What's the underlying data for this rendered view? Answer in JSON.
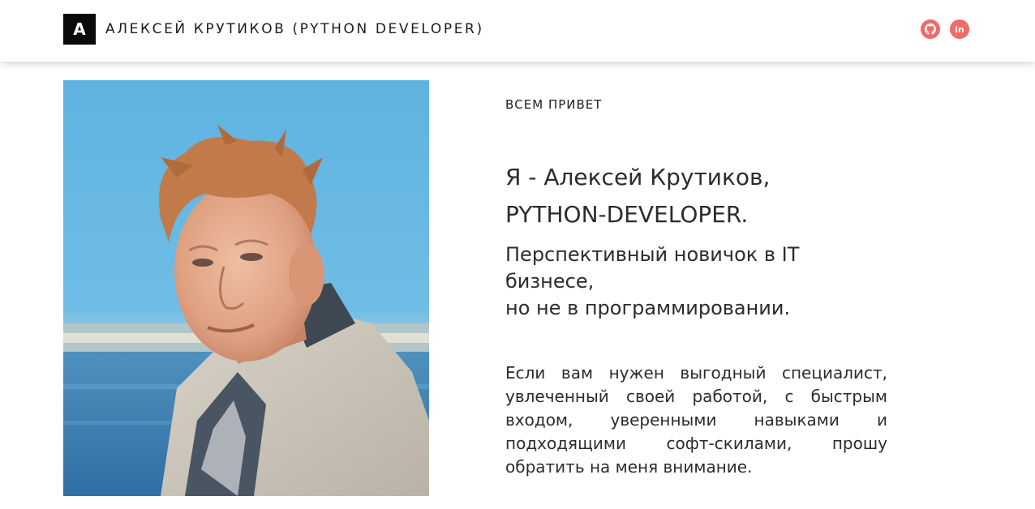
{
  "header": {
    "logo_letter": "A",
    "title": "АЛЕКСЕЙ КРУТИКОВ (PYTHON DEVELOPER)",
    "social": [
      {
        "name": "github",
        "icon": "github-icon"
      },
      {
        "name": "linkedin",
        "icon": "linkedin-icon",
        "glyph": "in"
      }
    ]
  },
  "main": {
    "greeting": "ВСЕМ ПРИВЕТ",
    "headline_line1": "Я - Алексей Крутиков,",
    "headline_line2": "PYTHON-DEVELOPER.",
    "subhead_line1": "Перспективный новичок в IT",
    "subhead_line2": "бизнесе,",
    "subhead_line3": "но не в программировании.",
    "paragraph": "Если вам нужен выгодный специалист, увлеченный своей работой, с быстрым входом, уверенными навыками и подходящими софт-скилами, прошу обратить на меня внимание."
  },
  "colors": {
    "accent": "#ee6b67",
    "logo_bg": "#0a0a0a",
    "text": "#2c2c2c"
  }
}
